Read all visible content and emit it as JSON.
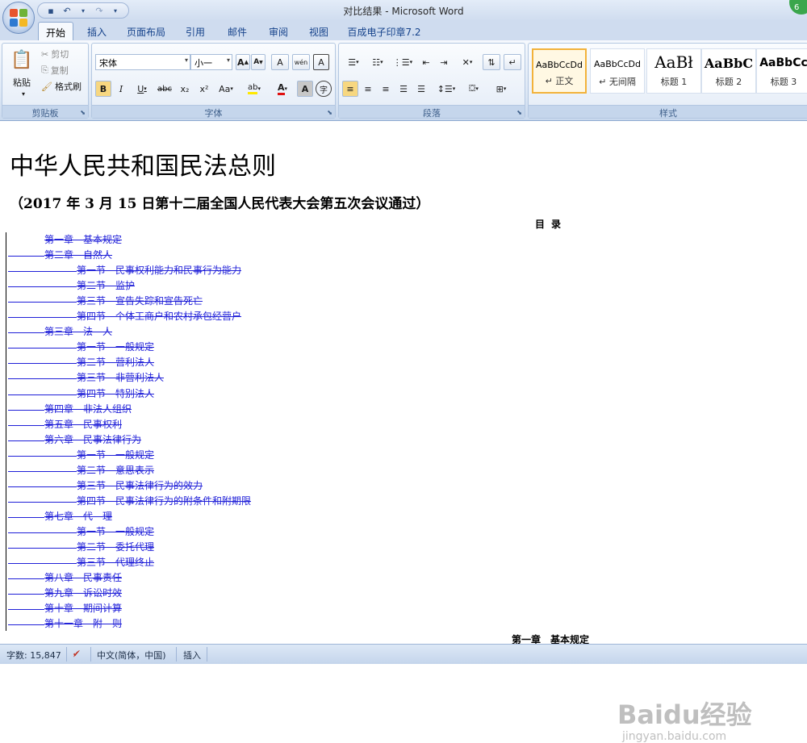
{
  "window": {
    "title": "对比结果 - Microsoft Word"
  },
  "qat": {
    "save": "save-icon",
    "undo": "undo-icon",
    "redo": "redo-icon"
  },
  "tabs": [
    "开始",
    "插入",
    "页面布局",
    "引用",
    "邮件",
    "审阅",
    "视图",
    "百成电子印章7.2"
  ],
  "clipboard": {
    "paste": "粘贴",
    "cut": "剪切",
    "copy": "复制",
    "format_painter": "格式刷",
    "label": "剪贴板"
  },
  "font": {
    "name": "宋体",
    "size": "小一",
    "label": "字体",
    "bold": "B",
    "italic": "I",
    "underline": "U",
    "strike": "abc",
    "sub": "x₂",
    "sup": "x²",
    "case": "Aa",
    "grow": "A",
    "shrink": "A",
    "clear": "A",
    "phonetic": "wén",
    "charborder": "A",
    "highlight": "ab",
    "fontcolor": "A",
    "shade": "A",
    "enclose": "字"
  },
  "paragraph": {
    "label": "段落"
  },
  "styles": {
    "label": "样式",
    "items": [
      {
        "sample": "AaBbCcDd",
        "name": "正文"
      },
      {
        "sample": "AaBbCcDd",
        "name": "无间隔"
      },
      {
        "sample": "AaBł",
        "name": "标题 1"
      },
      {
        "sample": "AaBbC",
        "name": "标题 2"
      },
      {
        "sample": "AaBbCc",
        "name": "标题 3"
      }
    ]
  },
  "document": {
    "title": "中华人民共和国民法总则",
    "subtitle": "（2017 年 3 月 15 日第十二届全国人民代表大会第五次会议通过）",
    "toc_heading": "目录",
    "toc": [
      {
        "text": "第一章　基本规定",
        "level": 1,
        "lead": false
      },
      {
        "text": "第二章　自然人",
        "level": 1,
        "lead": true
      },
      {
        "text": "第一节　民事权利能力和民事行为能力",
        "level": 2,
        "lead": true
      },
      {
        "text": "第二节　监护",
        "level": 2,
        "lead": true
      },
      {
        "text": "第三节　宣告失踪和宣告死亡",
        "level": 2,
        "lead": true
      },
      {
        "text": "第四节　个体工商户和农村承包经营户",
        "level": 2,
        "lead": true
      },
      {
        "text": "第三章　法　人",
        "level": 1,
        "lead": true
      },
      {
        "text": "第一节　一般规定",
        "level": 2,
        "lead": true
      },
      {
        "text": "第二节　营利法人",
        "level": 2,
        "lead": true
      },
      {
        "text": "第三节　非营利法人",
        "level": 2,
        "lead": true
      },
      {
        "text": "第四节　特别法人",
        "level": 2,
        "lead": true
      },
      {
        "text": "第四章　非法人组织",
        "level": 1,
        "lead": true
      },
      {
        "text": "第五章　民事权利",
        "level": 1,
        "lead": true
      },
      {
        "text": "第六章　民事法律行为",
        "level": 1,
        "lead": true
      },
      {
        "text": "第一节　一般规定",
        "level": 2,
        "lead": true
      },
      {
        "text": "第二节　意思表示",
        "level": 2,
        "lead": true
      },
      {
        "text": "第三节　民事法律行为的效力",
        "level": 2,
        "lead": true
      },
      {
        "text": "第四节　民事法律行为的附条件和附期限",
        "level": 2,
        "lead": true
      },
      {
        "text": "第七章　代　理",
        "level": 1,
        "lead": true
      },
      {
        "text": "第一节　一般规定",
        "level": 2,
        "lead": true
      },
      {
        "text": "第二节　委托代理",
        "level": 2,
        "lead": true
      },
      {
        "text": "第三节　代理终止",
        "level": 2,
        "lead": true
      },
      {
        "text": "第八章　民事责任",
        "level": 1,
        "lead": true
      },
      {
        "text": "第九章　诉讼时效",
        "level": 1,
        "lead": true
      },
      {
        "text": "第十章　期间计算",
        "level": 1,
        "lead": true
      },
      {
        "text": "第十一章　附　则",
        "level": 1,
        "lead": true
      }
    ],
    "next_heading": "第一章　基本规定"
  },
  "watermark": {
    "big": "Baidu经验",
    "small": "jingyan.baidu.com"
  },
  "status": {
    "word_count": "字数: 15,847",
    "language": "中文(简体，中国)",
    "mode": "插入"
  },
  "colors": {
    "accent": "#15428b",
    "revision": "#1f1fd8",
    "selected_style": "#f2b23a"
  }
}
